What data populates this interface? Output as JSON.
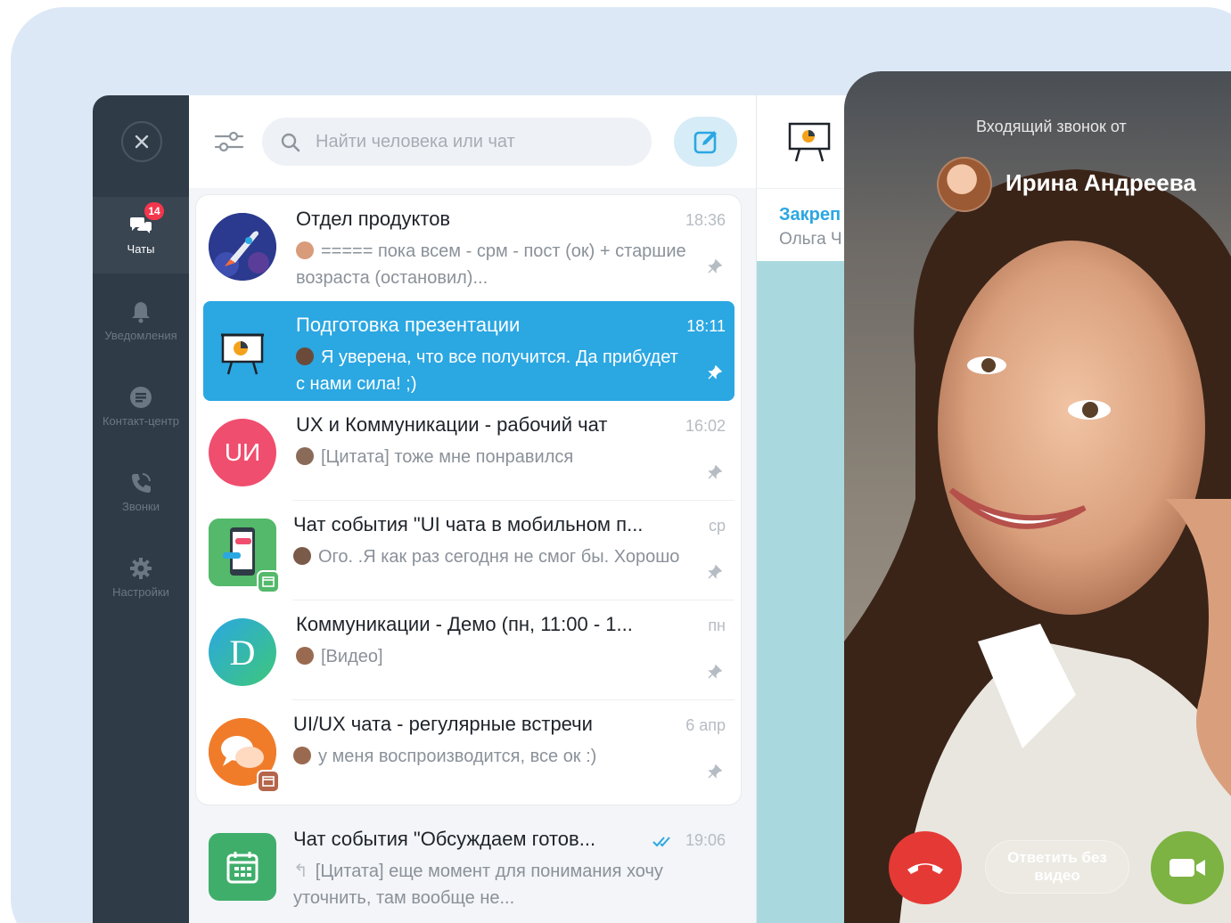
{
  "sidebar": {
    "items": [
      {
        "label": "Чаты",
        "badge": "14",
        "icon": "chat-bubbles-icon",
        "active": true
      },
      {
        "label": "Уведомления",
        "icon": "bell-icon"
      },
      {
        "label": "Контакт-центр",
        "icon": "contact-center-icon"
      },
      {
        "label": "Звонки",
        "icon": "phone-icon"
      },
      {
        "label": "Настройки",
        "icon": "gear-icon"
      }
    ]
  },
  "search": {
    "placeholder": "Найти человека или чат"
  },
  "chats": [
    {
      "title": "Отдел продуктов",
      "time": "18:36",
      "preview": "===== пока всем - срм - пост (ок) + старшие возраста (остановил)..."
    },
    {
      "title": "Подготовка презентации",
      "time": "18:11",
      "preview": "Я уверена, что все получится. Да прибудет с нами сила! ;)"
    },
    {
      "title": "UX и Коммуникации - рабочий чат",
      "time": "16:02",
      "preview": "[Цитата] тоже мне понравился",
      "avatar_text": "UИ"
    },
    {
      "title": "Чат события \"UI чата в мобильном п...",
      "time": "ср",
      "preview": "Ого. .Я как раз сегодня не смог бы. Хорошо"
    },
    {
      "title": "Коммуникации - Демо (пн, 11:00 - 1...",
      "time": "пн",
      "preview": "[Видео]",
      "avatar_text": "D"
    },
    {
      "title": "UI/UX чата - регулярные встречи",
      "time": "6 апр",
      "preview": "у меня воспроизводится, все ок :)"
    },
    {
      "title": "Чат события \"Обсуждаем готов...",
      "time": "19:06",
      "preview": "[Цитата] еще момент для понимания хочу уточнить, там вообще не..."
    }
  ],
  "mid": {
    "pinned_title": "Закреп",
    "pinned_name": "Ольга Ч"
  },
  "call": {
    "label": "Входящий звонок от",
    "caller": "Ирина Андреева",
    "no_video_label": "Ответить без видео"
  },
  "colors": {
    "accent": "#2ba7e2",
    "sidebar": "#2f3b46",
    "badge": "#f4364c",
    "decline": "#e53935",
    "accept": "#7cb342"
  }
}
